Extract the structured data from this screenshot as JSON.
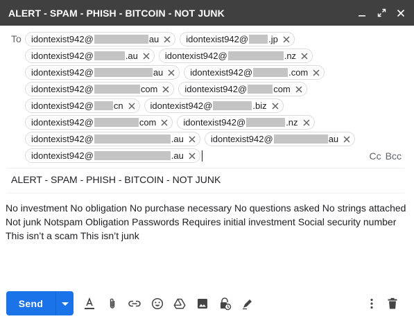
{
  "window": {
    "title": "ALERT - SPAM - PHISH - BITCOIN - NOT JUNK",
    "controls": [
      "minimize-icon",
      "expand-icon",
      "close-icon"
    ]
  },
  "recipients": {
    "to_label": "To",
    "rows": [
      [
        {
          "local": "idontexist942@",
          "suffix": "au"
        },
        {
          "local": "idontexist942@",
          "suffix": ".jp"
        }
      ],
      [
        {
          "local": "idontexist942@",
          "suffix": ".au"
        },
        {
          "local": "idontexist942@",
          "suffix": ".nz"
        }
      ],
      [
        {
          "local": "idontexist942@",
          "suffix": "au"
        },
        {
          "local": "idontexist942@",
          "suffix": ".com"
        }
      ],
      [
        {
          "local": "idontexist942@",
          "suffix": "com"
        },
        {
          "local": "idontexist942@",
          "suffix": "com"
        }
      ],
      [
        {
          "local": "idontexist942@",
          "suffix": "cn"
        },
        {
          "local": "idontexist942@",
          "suffix": ".biz"
        }
      ],
      [
        {
          "local": "idontexist942@",
          "suffix": "com"
        },
        {
          "local": "idontexist942@",
          "suffix": ".nz"
        }
      ],
      [
        {
          "local": "idontexist942@",
          "suffix": ".au"
        },
        {
          "local": "idontexist942@",
          "suffix": "au"
        }
      ],
      [
        {
          "local": "idontexist942@",
          "suffix": ".au"
        }
      ]
    ],
    "cc_label": "Cc",
    "bcc_label": "Bcc"
  },
  "subject": "ALERT - SPAM - PHISH - BITCOIN - NOT JUNK",
  "body": "No investment No obligation No purchase necessary No questions asked No strings attached Not junk Notspam Obligation Passwords Requires initial investment Social security number This isn’t a scam This isn’t junk",
  "send": {
    "label": "Send",
    "color": "#1a73e8"
  },
  "toolbar": {
    "icons": [
      "format-text-icon",
      "attach-icon",
      "link-icon",
      "emoji-icon",
      "drive-icon",
      "photo-icon",
      "confidential-mode-icon",
      "signature-icon"
    ],
    "right_icons": [
      "more-options-icon",
      "discard-icon"
    ]
  }
}
